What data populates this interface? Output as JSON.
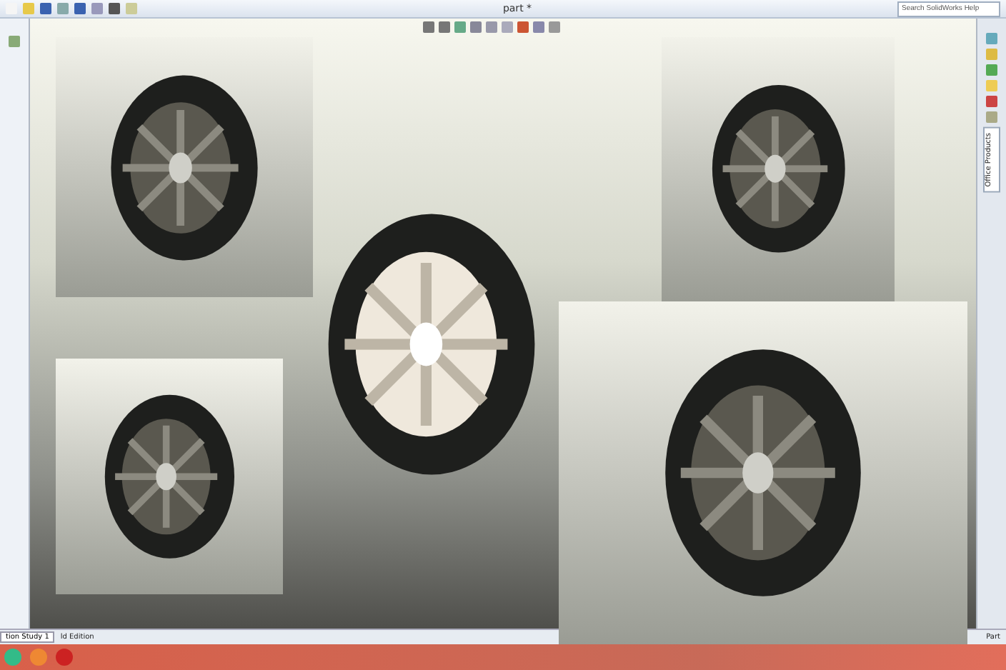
{
  "window": {
    "title": "part *"
  },
  "search": {
    "placeholder": "Search SolidWorks Help"
  },
  "task_pane_tabs": [
    {
      "label": "Office Products",
      "selected": true
    }
  ],
  "bottom_tabs": [
    {
      "label": "tion Study 1",
      "selected": true
    }
  ],
  "status_bar": {
    "left": "ld Edition",
    "right": "Part"
  }
}
